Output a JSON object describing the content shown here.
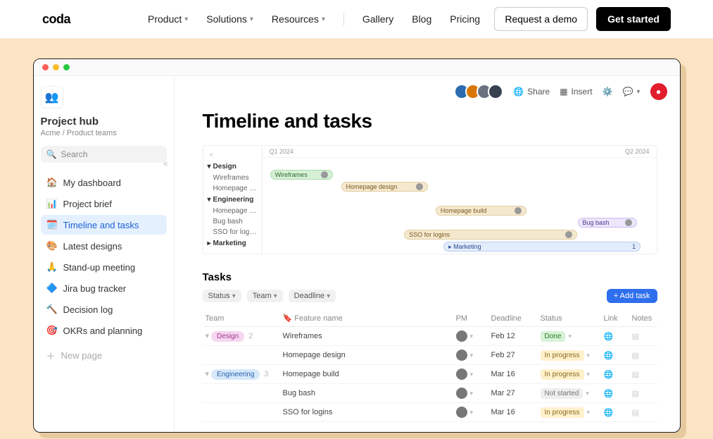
{
  "nav": {
    "logo": "coda",
    "items": [
      "Product",
      "Solutions",
      "Resources",
      "Gallery",
      "Blog",
      "Pricing"
    ],
    "demo": "Request a demo",
    "start": "Get started"
  },
  "doc": {
    "title": "Project hub",
    "breadcrumb": "Acme / Product teams",
    "search_placeholder": "Search"
  },
  "pages": [
    {
      "icon": "🏠",
      "label": "My dashboard"
    },
    {
      "icon": "📊",
      "label": "Project brief"
    },
    {
      "icon": "🗓️",
      "label": "Timeline and tasks",
      "active": true
    },
    {
      "icon": "🎨",
      "label": "Latest designs"
    },
    {
      "icon": "🙏",
      "label": "Stand-up meeting"
    },
    {
      "icon": "🔷",
      "label": "Jira bug tracker"
    },
    {
      "icon": "🔨",
      "label": "Decision log"
    },
    {
      "icon": "🎯",
      "label": "OKRs and planning"
    }
  ],
  "newpage": "New page",
  "toolbar": {
    "share": "Share",
    "insert": "Insert"
  },
  "page_title": "Timeline and tasks",
  "gantt": {
    "q1": "Q1 2024",
    "q2": "Q2 2024",
    "groups": [
      {
        "name": "Design",
        "rows": [
          "Wireframes",
          "Homepage desi…"
        ]
      },
      {
        "name": "Engineering",
        "rows": [
          "Homepage build",
          "Bug bash",
          "SSO for logins"
        ]
      },
      {
        "name": "Marketing",
        "rows": []
      }
    ],
    "bars": {
      "wire": "Wireframes",
      "home": "Homepage design",
      "build": "Homepage build",
      "bug": "Bug bash",
      "sso": "SSO for logins",
      "mkt": "Marketing",
      "mktcount": "1"
    }
  },
  "tasks": {
    "heading": "Tasks",
    "filters": [
      "Status",
      "Team",
      "Deadline"
    ],
    "add": "+ Add task",
    "cols": {
      "team": "Team",
      "feature": "Feature name",
      "pm": "PM",
      "deadline": "Deadline",
      "status": "Status",
      "link": "Link",
      "notes": "Notes"
    },
    "groups": [
      {
        "team": "Design",
        "count": "2",
        "rows": [
          {
            "feature": "Wireframes",
            "deadline": "Feb 12",
            "status": "Done",
            "statusCls": "done"
          },
          {
            "feature": "Homepage design",
            "deadline": "Feb 27",
            "status": "In progress",
            "statusCls": "prog"
          }
        ]
      },
      {
        "team": "Engineering",
        "count": "3",
        "rows": [
          {
            "feature": "Homepage build",
            "deadline": "Mar 16",
            "status": "In progress",
            "statusCls": "prog"
          },
          {
            "feature": "Bug bash",
            "deadline": "Mar 27",
            "status": "Not started",
            "statusCls": "not"
          },
          {
            "feature": "SSO for logins",
            "deadline": "Mar 16",
            "status": "In progress",
            "statusCls": "prog"
          }
        ]
      }
    ]
  }
}
